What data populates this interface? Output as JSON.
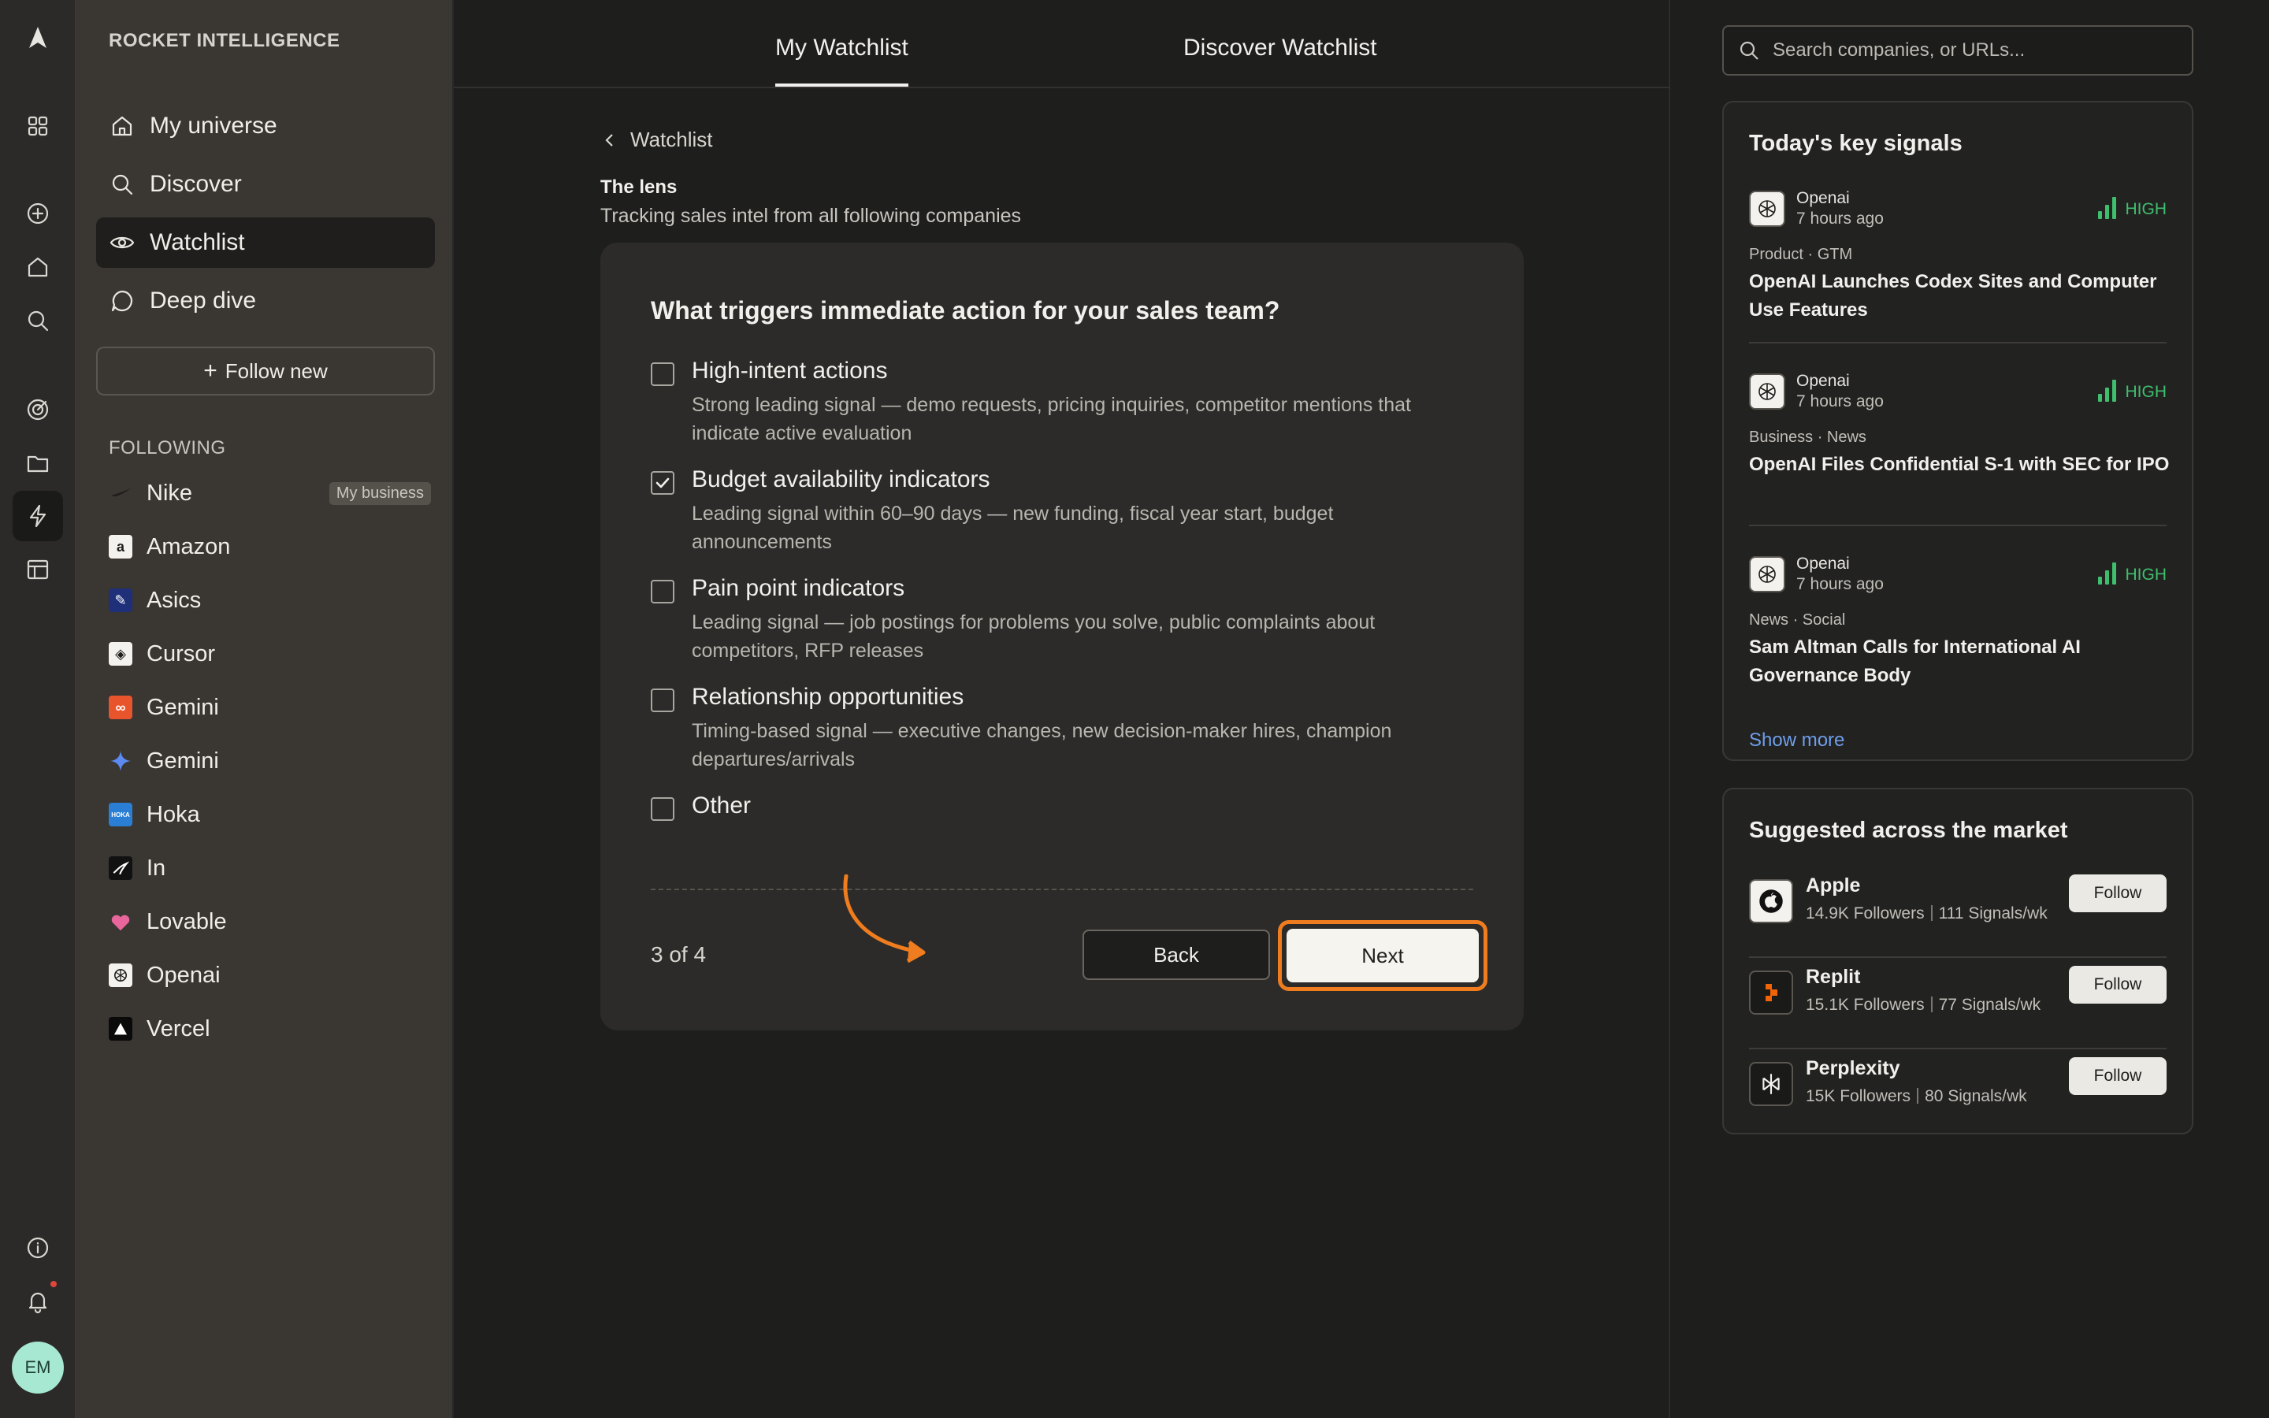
{
  "app": {
    "brand": "ROCKET INTELLIGENCE",
    "avatar_initials": "EM"
  },
  "sidebar": {
    "nav": [
      {
        "label": "My universe",
        "icon": "home-icon"
      },
      {
        "label": "Discover",
        "icon": "search-icon"
      },
      {
        "label": "Watchlist",
        "icon": "eye-icon",
        "active": true
      },
      {
        "label": "Deep dive",
        "icon": "chat-bubble-icon"
      }
    ],
    "follow_new": "Follow new",
    "following_label": "FOLLOWING",
    "companies": [
      {
        "name": "Nike",
        "tag": "My business"
      },
      {
        "name": "Amazon"
      },
      {
        "name": "Asics"
      },
      {
        "name": "Cursor"
      },
      {
        "name": "Gemini"
      },
      {
        "name": "Gemini"
      },
      {
        "name": "Hoka"
      },
      {
        "name": "In"
      },
      {
        "name": "Lovable"
      },
      {
        "name": "Openai"
      },
      {
        "name": "Vercel"
      }
    ]
  },
  "main": {
    "tabs": [
      {
        "label": "My Watchlist",
        "active": true
      },
      {
        "label": "Discover Watchlist"
      }
    ],
    "breadcrumb": "Watchlist",
    "lens_title": "The lens",
    "lens_subtitle": "Tracking sales intel from all following companies",
    "question": "What triggers immediate action for your sales team?",
    "options": [
      {
        "title": "High-intent actions",
        "desc": "Strong leading signal — demo requests, pricing inquiries, competitor mentions that indicate active evaluation",
        "checked": false
      },
      {
        "title": "Budget availability indicators",
        "desc": "Leading signal within 60–90 days — new funding, fiscal year start, budget announcements",
        "checked": true
      },
      {
        "title": "Pain point indicators",
        "desc": "Leading signal — job postings for problems you solve, public complaints about competitors, RFP releases",
        "checked": false
      },
      {
        "title": "Relationship opportunities",
        "desc": "Timing-based signal — executive changes, new decision-maker hires, champion departures/arrivals",
        "checked": false
      },
      {
        "title": "Other",
        "desc": "",
        "checked": false
      }
    ],
    "step": "3 of 4",
    "back_label": "Back",
    "next_label": "Next",
    "highlight_color": "#ef7d1f"
  },
  "right": {
    "search_placeholder": "Search companies, or URLs...",
    "signals_title": "Today's key signals",
    "signals": [
      {
        "source": "Openai",
        "time": "7 hours ago",
        "level": "HIGH",
        "category": "Product · GTM",
        "headline": "OpenAI Launches Codex Sites and Computer Use Features"
      },
      {
        "source": "Openai",
        "time": "7 hours ago",
        "level": "HIGH",
        "category": "Business · News",
        "headline": "OpenAI Files Confidential S-1 with SEC for IPO"
      },
      {
        "source": "Openai",
        "time": "7 hours ago",
        "level": "HIGH",
        "category": "News · Social",
        "headline": "Sam Altman Calls for International AI Governance Body"
      }
    ],
    "show_more": "Show more",
    "suggested_title": "Suggested across the market",
    "suggested": [
      {
        "name": "Apple",
        "followers": "14.9K Followers",
        "signals": "111 Signals/wk",
        "button": "Follow"
      },
      {
        "name": "Replit",
        "followers": "15.1K Followers",
        "signals": "77 Signals/wk",
        "button": "Follow"
      },
      {
        "name": "Perplexity",
        "followers": "15K Followers",
        "signals": "80 Signals/wk",
        "button": "Follow"
      }
    ],
    "level_color": "#3fbf6e"
  }
}
